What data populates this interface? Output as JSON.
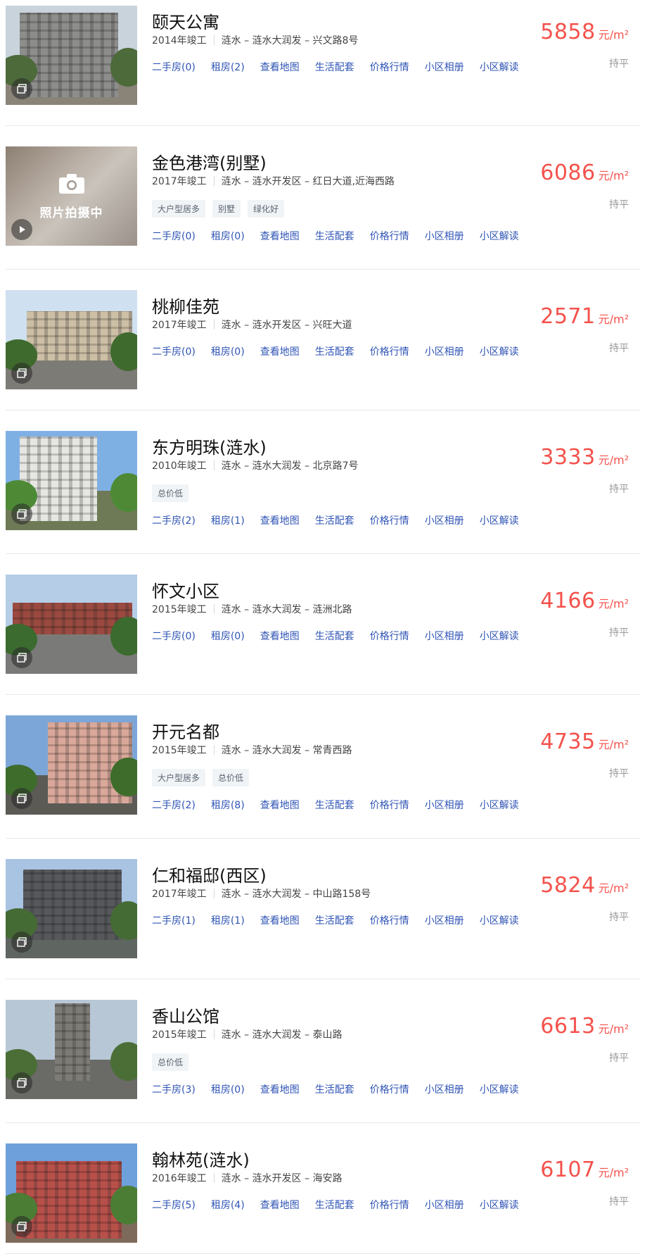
{
  "listings": [
    {
      "name": "颐天公寓",
      "year": "2014年竣工",
      "location": "涟水 – 涟水大润发 – 兴文路8号",
      "tags": [],
      "links": [
        "二手房(0)",
        "租房(2)",
        "查看地图",
        "生活配套",
        "价格行情",
        "小区相册",
        "小区解读"
      ],
      "price": "5858",
      "unit": "元/m²",
      "trend": "持平",
      "has_photo": true,
      "photo_icon": "album-icon"
    },
    {
      "name": "金色港湾(别墅)",
      "year": "2017年竣工",
      "location": "涟水 – 涟水开发区 – 红日大道,近海西路",
      "tags": [
        "大户型居多",
        "别墅",
        "绿化好"
      ],
      "links": [
        "二手房(0)",
        "租房(0)",
        "查看地图",
        "生活配套",
        "价格行情",
        "小区相册",
        "小区解读"
      ],
      "price": "6086",
      "unit": "元/m²",
      "trend": "持平",
      "has_photo": false,
      "placeholder_text": "照片拍摄中",
      "photo_icon": "video-play-icon"
    },
    {
      "name": "桃柳佳苑",
      "year": "2017年竣工",
      "location": "涟水 – 涟水开发区 – 兴旺大道",
      "tags": [],
      "links": [
        "二手房(0)",
        "租房(0)",
        "查看地图",
        "生活配套",
        "价格行情",
        "小区相册",
        "小区解读"
      ],
      "price": "2571",
      "unit": "元/m²",
      "trend": "持平",
      "has_photo": true,
      "photo_icon": "album-icon"
    },
    {
      "name": "东方明珠(涟水)",
      "year": "2010年竣工",
      "location": "涟水 – 涟水大润发 – 北京路7号",
      "tags": [
        "总价低"
      ],
      "links": [
        "二手房(2)",
        "租房(1)",
        "查看地图",
        "生活配套",
        "价格行情",
        "小区相册",
        "小区解读"
      ],
      "price": "3333",
      "unit": "元/m²",
      "trend": "持平",
      "has_photo": true,
      "photo_icon": "album-icon"
    },
    {
      "name": "怀文小区",
      "year": "2015年竣工",
      "location": "涟水 – 涟水大润发 – 涟洲北路",
      "tags": [],
      "links": [
        "二手房(0)",
        "租房(0)",
        "查看地图",
        "生活配套",
        "价格行情",
        "小区相册",
        "小区解读"
      ],
      "price": "4166",
      "unit": "元/m²",
      "trend": "持平",
      "has_photo": true,
      "photo_icon": "album-icon"
    },
    {
      "name": "开元名都",
      "year": "2015年竣工",
      "location": "涟水 – 涟水大润发 – 常青西路",
      "tags": [
        "大户型居多",
        "总价低"
      ],
      "links": [
        "二手房(2)",
        "租房(8)",
        "查看地图",
        "生活配套",
        "价格行情",
        "小区相册",
        "小区解读"
      ],
      "price": "4735",
      "unit": "元/m²",
      "trend": "持平",
      "has_photo": true,
      "photo_icon": "album-icon"
    },
    {
      "name": "仁和福邸(西区)",
      "year": "2017年竣工",
      "location": "涟水 – 涟水大润发 – 中山路158号",
      "tags": [],
      "links": [
        "二手房(1)",
        "租房(1)",
        "查看地图",
        "生活配套",
        "价格行情",
        "小区相册",
        "小区解读"
      ],
      "price": "5824",
      "unit": "元/m²",
      "trend": "持平",
      "has_photo": true,
      "photo_icon": "album-icon"
    },
    {
      "name": "香山公馆",
      "year": "2015年竣工",
      "location": "涟水 – 涟水大润发 – 泰山路",
      "tags": [
        "总价低"
      ],
      "links": [
        "二手房(3)",
        "租房(0)",
        "查看地图",
        "生活配套",
        "价格行情",
        "小区相册",
        "小区解读"
      ],
      "price": "6613",
      "unit": "元/m²",
      "trend": "持平",
      "has_photo": true,
      "photo_icon": "album-icon"
    },
    {
      "name": "翰林苑(涟水)",
      "year": "2016年竣工",
      "location": "涟水 – 涟水开发区 – 海安路",
      "tags": [],
      "links": [
        "二手房(5)",
        "租房(4)",
        "查看地图",
        "生活配套",
        "价格行情",
        "小区相册",
        "小区解读"
      ],
      "price": "6107",
      "unit": "元/m²",
      "trend": "持平",
      "has_photo": true,
      "photo_icon": "album-icon"
    }
  ],
  "colors": {
    "price": "#f4524c",
    "link": "#2f54b5",
    "tag_bg": "#f1f4f6",
    "divider": "#e8e8e8"
  }
}
